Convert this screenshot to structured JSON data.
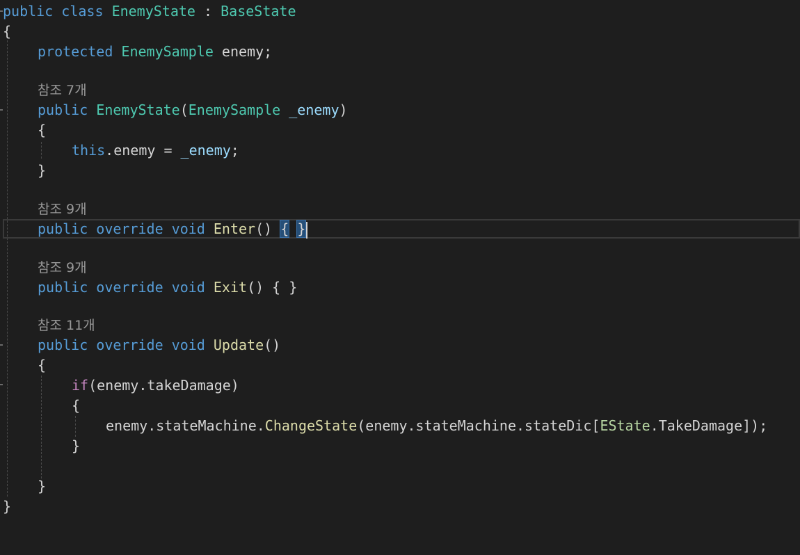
{
  "code": {
    "class_decl": {
      "public": "public",
      "class": "class",
      "name": "EnemyState",
      "colon": " : ",
      "base": "BaseState"
    },
    "open_class": "{",
    "field": {
      "modifier": "protected",
      "type": "EnemySample",
      "name": " enemy;"
    },
    "lens_ctor": "참조 7개",
    "ctor_sig": {
      "public": "public",
      "name": "EnemyState",
      "open": "(",
      "ptype": "EnemySample",
      "pname": "_enemy",
      "close": ")"
    },
    "ctor_open": "{",
    "ctor_body": {
      "this": "this",
      "member": ".enemy = ",
      "value": "_enemy",
      "semi": ";"
    },
    "ctor_close": "}",
    "lens_enter": "참조 9개",
    "enter_sig": {
      "public": "public",
      "override": "override",
      "void": "void",
      "name": "Enter",
      "parens": "() ",
      "open": "{",
      "space": " ",
      "close": "}"
    },
    "lens_exit": "참조 9개",
    "exit_sig": {
      "public": "public",
      "override": "override",
      "void": "void",
      "name": "Exit",
      "rest": "() { }"
    },
    "lens_update": "참조 11개",
    "update_sig": {
      "public": "public",
      "override": "override",
      "void": "void",
      "name": "Update",
      "parens": "()"
    },
    "update_open": "{",
    "if_line": {
      "if": "if",
      "cond": "(enemy.takeDamage)"
    },
    "if_open": "{",
    "call_line": {
      "obj": "enemy.stateMachine.",
      "method": "ChangeState",
      "args_start": "(enemy.stateMachine.stateDic[",
      "enum": "EState",
      "args_end": ".TakeDamage]);"
    },
    "if_close": "}",
    "update_close": "}",
    "close_class": "}"
  },
  "colors": {
    "background": "#1e1e1e",
    "keyword": "#569cd6",
    "control": "#c586c0",
    "type": "#4ec9b0",
    "function": "#dcdcaa",
    "parameter": "#9cdcfe",
    "text": "#d4d4d4",
    "codelens": "#999999"
  }
}
